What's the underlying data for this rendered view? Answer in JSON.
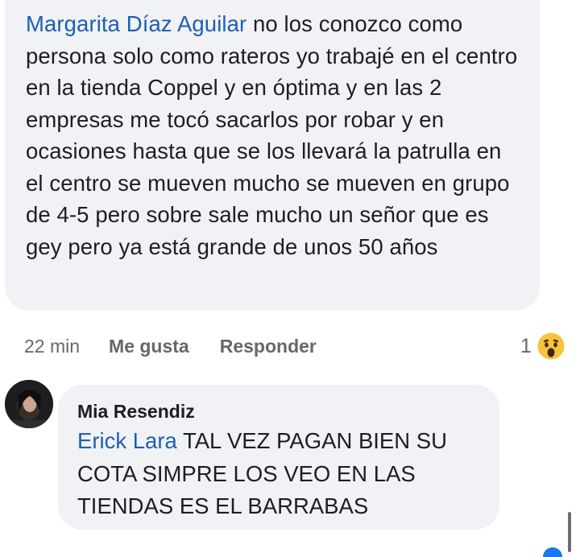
{
  "top_comment": {
    "mention": "Margarita Díaz Aguilar",
    "text": " no los conozco como persona solo como rateros yo trabajé en el centro en la tienda Coppel y en óptima y en las 2 empresas me tocó sacarlos por robar y en ocasiones hasta que se los llevará la patrulla en el centro se mueven mucho se mueven en grupo de 4-5 pero sobre sale mucho un señor que es gey pero ya está grande de unos 50 años"
  },
  "meta": {
    "time": "22 min",
    "like_label": "Me gusta",
    "reply_label": "Responder",
    "reaction_count": "1",
    "reaction_icon": "wow-icon"
  },
  "reply": {
    "author": "Mia Resendiz",
    "mention": "Erick Lara",
    "text": " TAL VEZ PAGAN BIEN SU COTA SIMPRE LOS VEO EN LAS TIENDAS ES EL BARRABAS"
  },
  "colors": {
    "bubble": "#f0f2f5",
    "mention": "#1f5fb0",
    "meta": "#65676b",
    "text": "#1c1e21",
    "accent": "#1877f2"
  }
}
